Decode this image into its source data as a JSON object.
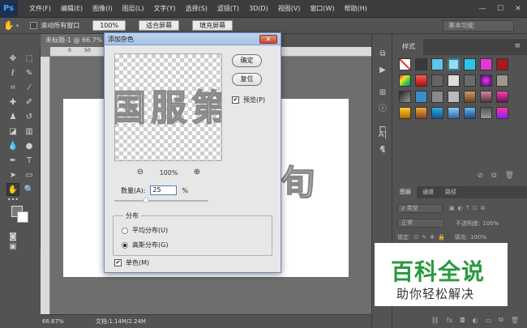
{
  "app": {
    "logo": "Ps"
  },
  "menu": [
    "文件(F)",
    "编辑(E)",
    "图像(I)",
    "图层(L)",
    "文字(Y)",
    "选择(S)",
    "滤镜(T)",
    "3D(D)",
    "视图(V)",
    "窗口(W)",
    "帮助(H)"
  ],
  "options_bar": {
    "scroll_all_label": "滚动所有窗口",
    "zoom_value": "100%",
    "fit_screen_label": "适合屏幕",
    "fill_screen_label": "填充屏幕",
    "workspace": "基本功能"
  },
  "document": {
    "tab_title": "未标题-1 @ 66.7%",
    "ruler_ticks": [
      "0",
      "50"
    ],
    "zoom_status": "66.67%",
    "doc_status": "文档:1.14M/2.24M"
  },
  "dialog": {
    "title": "添加杂色",
    "ok_label": "确定",
    "reset_label": "复位",
    "preview_label": "预览(P)",
    "preview_checked": true,
    "preview_zoom": "100%",
    "amount_label": "数量(A):",
    "amount_value": "25",
    "amount_unit": "%",
    "distribution_legend": "分布",
    "uniform_label": "平均分布(U)",
    "gaussian_label": "高斯分布(G)",
    "selected_distribution": "gaussian",
    "monochromatic_label": "单色(M)",
    "monochromatic_checked": true
  },
  "styles_panel": {
    "tab_label": "样式"
  },
  "layers_panel": {
    "tabs": [
      "图层",
      "通道",
      "路径"
    ],
    "kind_label": "ρ 类型",
    "blend_mode": "正常",
    "opacity_label": "不透明度:",
    "opacity_value": "100%",
    "lock_label": "锁定:",
    "fill_label": "填充:",
    "fill_value": "100%"
  },
  "watermark": {
    "title": "百科全说",
    "subtitle": "助你轻松解决"
  },
  "colors": {
    "foreground": "#7a7a7a",
    "background": "#ffffff",
    "brand_green": "#2a9a3c"
  }
}
